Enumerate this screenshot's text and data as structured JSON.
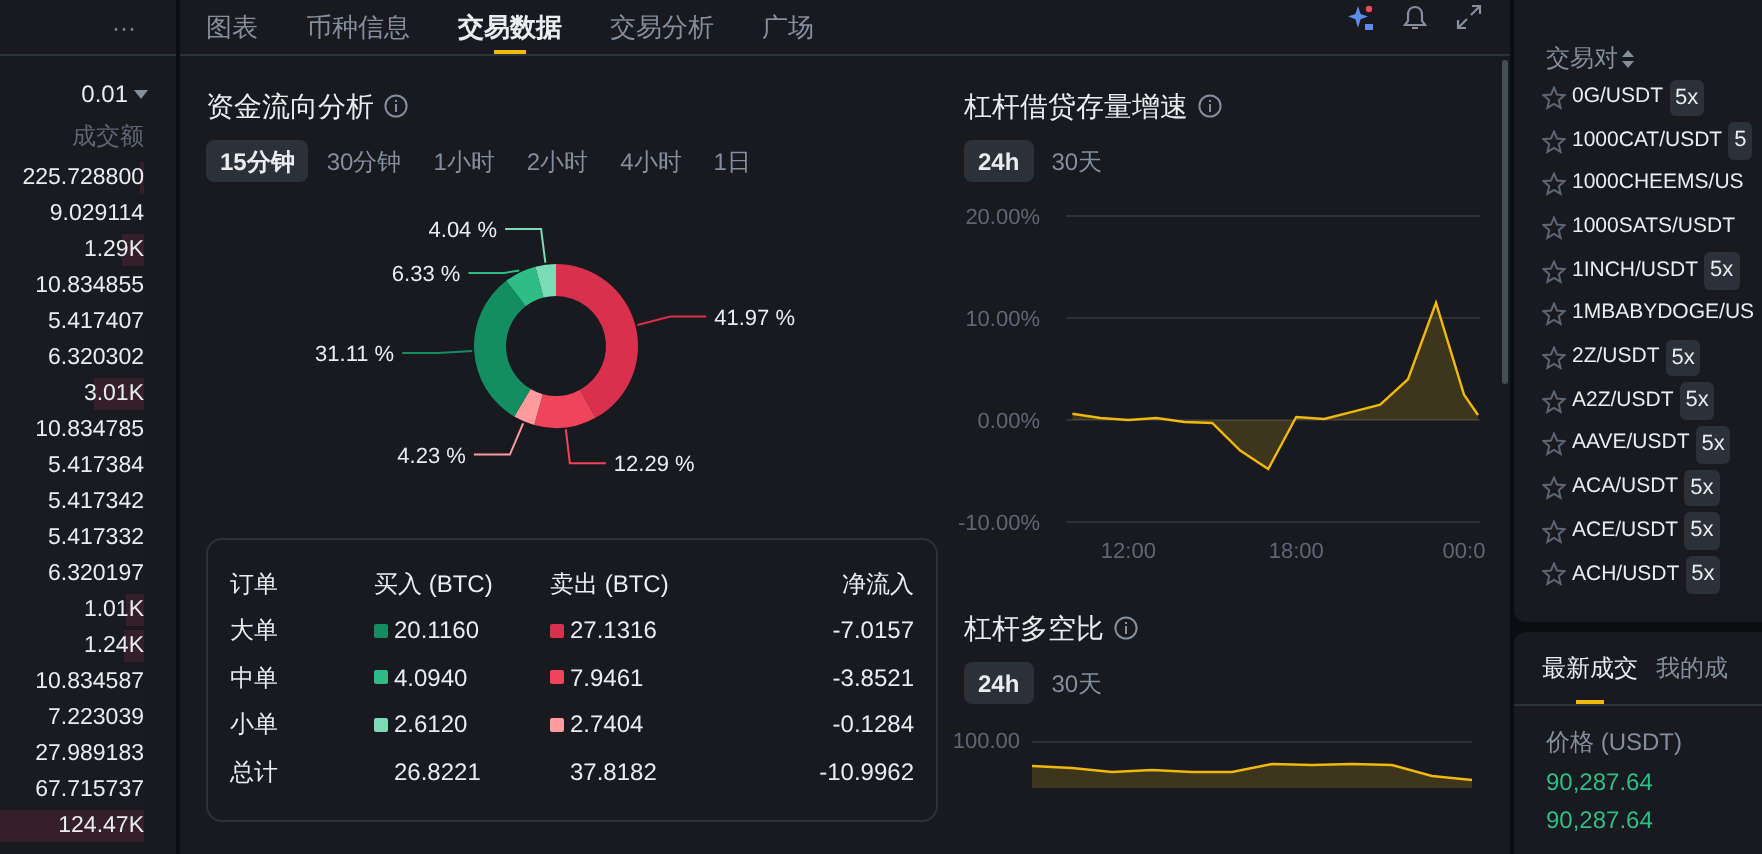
{
  "orderbook": {
    "more_icon": "···",
    "precision": "0.01",
    "column": "成交额",
    "rows": [
      {
        "value": "225.728800",
        "level": 0.03
      },
      {
        "value": "9.029114",
        "level": 0
      },
      {
        "value": "1.29K",
        "level": 0.15
      },
      {
        "value": "10.834855",
        "level": 0
      },
      {
        "value": "5.417407",
        "level": 0
      },
      {
        "value": "6.320302",
        "level": 0
      },
      {
        "value": "3.01K",
        "level": 0.35
      },
      {
        "value": "10.834785",
        "level": 0
      },
      {
        "value": "5.417384",
        "level": 0
      },
      {
        "value": "5.417342",
        "level": 0
      },
      {
        "value": "5.417332",
        "level": 0
      },
      {
        "value": "6.320197",
        "level": 0
      },
      {
        "value": "1.01K",
        "level": 0.12
      },
      {
        "value": "1.24K",
        "level": 0.14
      },
      {
        "value": "10.834587",
        "level": 0
      },
      {
        "value": "7.223039",
        "level": 0
      },
      {
        "value": "27.989183",
        "level": 0
      },
      {
        "value": "67.715737",
        "level": 0
      },
      {
        "value": "124.47K",
        "level": 1
      }
    ]
  },
  "tabs": [
    {
      "label": "图表",
      "selected": false
    },
    {
      "label": "币种信息",
      "selected": false
    },
    {
      "label": "交易数据",
      "selected": true
    },
    {
      "label": "交易分析",
      "selected": false
    },
    {
      "label": "广场",
      "selected": false
    }
  ],
  "fund_flow": {
    "title": "资金流向分析",
    "periods": [
      {
        "label": "15分钟",
        "selected": true
      },
      {
        "label": "30分钟",
        "selected": false
      },
      {
        "label": "1小时",
        "selected": false
      },
      {
        "label": "2小时",
        "selected": false
      },
      {
        "label": "4小时",
        "selected": false
      },
      {
        "label": "1日",
        "selected": false
      }
    ],
    "chart_data": {
      "type": "donut",
      "values": [
        41.97,
        12.29,
        4.23,
        31.11,
        6.33,
        4.04
      ],
      "colors": [
        "#d9304e",
        "#f0435c",
        "#ff9a9f",
        "#138d62",
        "#2ebd85",
        "#7adbb4"
      ],
      "value_labels": [
        "41.97 %",
        "12.29 %",
        "4.23 %",
        "31.11 %",
        "6.33 %",
        "4.04 %"
      ]
    },
    "table": {
      "columns": [
        "订单",
        "买入 (BTC)",
        "卖出 (BTC)",
        "净流入"
      ],
      "rows": [
        {
          "order": "大单",
          "buy": {
            "value": "20.1160",
            "color": "#138d62"
          },
          "sell": {
            "value": "27.1316",
            "color": "#d9304e"
          },
          "net": "-7.0157"
        },
        {
          "order": "中单",
          "buy": {
            "value": "4.0940",
            "color": "#2ebd85"
          },
          "sell": {
            "value": "7.9461",
            "color": "#f0435c"
          },
          "net": "-3.8521"
        },
        {
          "order": "小单",
          "buy": {
            "value": "2.6120",
            "color": "#7adbb4"
          },
          "sell": {
            "value": "2.7404",
            "color": "#ff9a9f"
          },
          "net": "-0.1284"
        },
        {
          "order": "总计",
          "buy": {
            "value": "26.8221"
          },
          "sell": {
            "value": "37.8182"
          },
          "net": "-10.9962"
        }
      ]
    }
  },
  "margin_growth": {
    "title": "杠杆借贷存量增速",
    "periods": [
      {
        "label": "24h",
        "selected": true
      },
      {
        "label": "30天",
        "selected": false
      }
    ],
    "chart_data": {
      "type": "area",
      "x": [
        10,
        11,
        12,
        13,
        14,
        15,
        16,
        17,
        18,
        19,
        20,
        21,
        22,
        23,
        24,
        24.5
      ],
      "series": [
        {
          "color": "#f0b90b",
          "values": [
            0.6,
            0.2,
            0,
            0.2,
            -0.2,
            -0.3,
            -3,
            -4.8,
            0.3,
            0.1,
            0.8,
            1.5,
            4,
            11.5,
            2.5,
            0.5
          ]
        }
      ],
      "xlim": [
        9.77,
        24.5
      ],
      "ylim": [
        -10,
        20
      ],
      "xticks": [
        {
          "value": 12,
          "label": "12:00"
        },
        {
          "value": 18,
          "label": "18:00"
        },
        {
          "value": 24,
          "label": "00:0"
        }
      ],
      "yticks": [
        {
          "value": 20,
          "label": "20.00%"
        },
        {
          "value": 10,
          "label": "10.00%"
        },
        {
          "value": 0,
          "label": "0.00%"
        },
        {
          "value": -10,
          "label": "-10.00%"
        }
      ]
    }
  },
  "margin_ratio": {
    "title": "杠杆多空比",
    "periods": [
      {
        "label": "24h",
        "selected": true
      },
      {
        "label": "30天",
        "selected": false
      }
    ],
    "tick_label": "100.00"
  },
  "pairs": {
    "header": "交易对",
    "items": [
      {
        "symbol": "0G/USDT",
        "badge": "5x"
      },
      {
        "symbol": "1000CAT/USDT",
        "badge": "5"
      },
      {
        "symbol": "1000CHEEMS/US"
      },
      {
        "symbol": "1000SATS/USDT"
      },
      {
        "symbol": "1INCH/USDT",
        "badge": "5x"
      },
      {
        "symbol": "1MBABYDOGE/US"
      },
      {
        "symbol": "2Z/USDT",
        "badge": "5x"
      },
      {
        "symbol": "A2Z/USDT",
        "badge": "5x"
      },
      {
        "symbol": "AAVE/USDT",
        "badge": "5x"
      },
      {
        "symbol": "ACA/USDT",
        "badge": "5x"
      },
      {
        "symbol": "ACE/USDT",
        "badge": "5x"
      },
      {
        "symbol": "ACH/USDT",
        "badge": "5x"
      }
    ]
  },
  "trades": {
    "tabs": [
      {
        "label": "最新成交",
        "selected": true
      },
      {
        "label": "我的成",
        "selected": false
      }
    ],
    "price_header": "价格 (USDT)",
    "prices": [
      "90,287.64",
      "90,287.64"
    ]
  }
}
